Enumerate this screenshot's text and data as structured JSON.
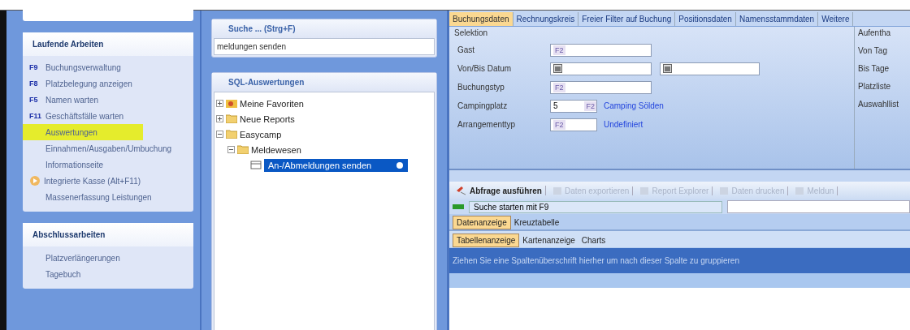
{
  "sidebar": {
    "groups": [
      {
        "title": "Laufende Arbeiten",
        "items": [
          {
            "label": "Buchungsverwaltung",
            "key": "F9",
            "selected": false
          },
          {
            "label": "Platzbelegung anzeigen",
            "key": "F8",
            "selected": false
          },
          {
            "label": "Namen warten",
            "key": "F5",
            "selected": false
          },
          {
            "label": "Geschäftsfälle warten",
            "key": "F11",
            "selected": false
          },
          {
            "label": "Auswertungen",
            "selected": true
          },
          {
            "label": "Einnahmen/Ausgaben/Umbuchung",
            "selected": false
          },
          {
            "label": "Informationseite",
            "selected": false
          },
          {
            "label": "Integrierte Kasse (Alt+F11)",
            "kind": "play",
            "selected": false
          },
          {
            "label": "Massenerfassung Leistungen",
            "selected": false
          }
        ]
      },
      {
        "title": "Abschlussarbeiten",
        "items": [
          {
            "label": "Platzverlängerungen",
            "selected": false
          },
          {
            "label": "Tagebuch",
            "selected": false
          }
        ]
      }
    ]
  },
  "search": {
    "title": "Suche ... (Strg+F)",
    "value": "meldungen senden"
  },
  "tree": {
    "title": "SQL-Auswertungen",
    "items": [
      {
        "label": "Meine Favoriten",
        "kind": "favorites",
        "expanded": false,
        "selected": false
      },
      {
        "label": "Neue Reports",
        "kind": "folder",
        "expanded": false,
        "selected": false
      },
      {
        "label": "Easycamp",
        "kind": "folder",
        "expanded": true,
        "selected": false,
        "children": [
          {
            "label": "Meldewesen",
            "kind": "folder",
            "expanded": true,
            "selected": false,
            "children": [
              {
                "label": "An-/Abmeldungen senden",
                "kind": "report",
                "selected": true
              }
            ]
          }
        ]
      }
    ]
  },
  "tabs": [
    {
      "label": "Buchungsdaten",
      "selected": true
    },
    {
      "label": "Rechnungskreis",
      "selected": false
    },
    {
      "label": "Freier Filter auf Buchung",
      "selected": false
    },
    {
      "label": "Positionsdaten",
      "selected": false
    },
    {
      "label": "Namensstammdaten",
      "selected": false
    },
    {
      "label": "Weitere",
      "selected": false
    }
  ],
  "selection": {
    "title": "Selektion",
    "rows": [
      {
        "label": "Gast",
        "kind": "lookup",
        "key": "F2"
      },
      {
        "label": "Von/Bis Datum",
        "kind": "daterange"
      },
      {
        "label": "Buchungstyp",
        "kind": "lookup",
        "key": "F2"
      },
      {
        "label": "Campingplatz",
        "kind": "short",
        "value": "5",
        "key": "F2",
        "link": "Camping Sölden"
      },
      {
        "label": "Arrangementtyp",
        "kind": "short",
        "key": "F2",
        "link": "Undefiniert"
      }
    ]
  },
  "stay": {
    "title": "Aufentha",
    "labels": [
      "Von Tag",
      "Bis Tage",
      "Platzliste",
      "Auswahllist"
    ]
  },
  "toolbar": [
    {
      "label": "Abfrage ausführen",
      "disabled": false
    },
    {
      "label": "Daten exportieren",
      "disabled": true
    },
    {
      "label": "Report Explorer",
      "disabled": true
    },
    {
      "label": "Daten drucken",
      "disabled": true
    },
    {
      "label": "Meldun",
      "disabled": true
    }
  ],
  "status": {
    "text": "Suche starten mit F9"
  },
  "view_tabs": [
    {
      "label": "Datenanzeige",
      "selected": true
    },
    {
      "label": "Kreuztabelle",
      "selected": false
    }
  ],
  "sub_tabs": [
    {
      "label": "Tabellenanzeige",
      "selected": true
    },
    {
      "label": "Kartenanzeige",
      "selected": false
    },
    {
      "label": "Charts",
      "selected": false
    }
  ],
  "group_bar": {
    "text": "Ziehen Sie eine Spaltenüberschrift hierher um nach dieser Spalte zu gruppieren"
  }
}
